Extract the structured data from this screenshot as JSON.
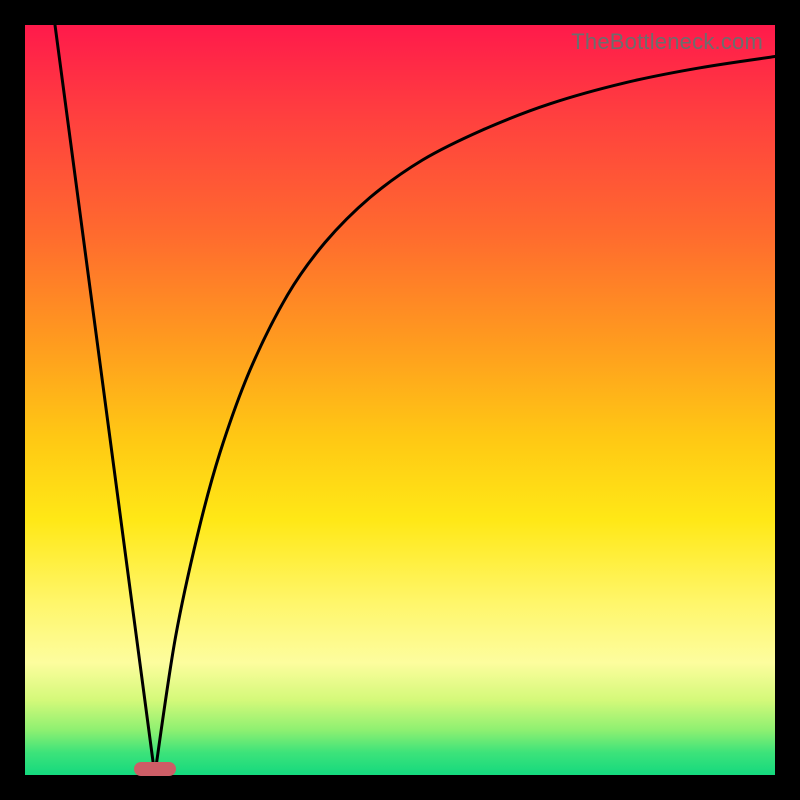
{
  "watermark": "TheBottleneck.com",
  "chart_data": {
    "type": "line",
    "title": "",
    "xlabel": "",
    "ylabel": "",
    "xlim": [
      0,
      100
    ],
    "ylim": [
      0,
      100
    ],
    "grid": false,
    "series": [
      {
        "name": "left-branch",
        "x": [
          4,
          17.3
        ],
        "y": [
          100,
          0
        ]
      },
      {
        "name": "right-branch",
        "x": [
          17.3,
          20,
          23,
          26,
          30,
          35,
          40,
          46,
          53,
          61,
          70,
          80,
          90,
          100
        ],
        "y": [
          0,
          18,
          32,
          43,
          54,
          64,
          71,
          77,
          82,
          86,
          89.5,
          92.3,
          94.3,
          95.8
        ]
      }
    ],
    "marker": {
      "x": 17.3,
      "y": 0
    },
    "background_gradient": {
      "top": "#ff1a4b",
      "upper_mid": "#ff9a1f",
      "mid": "#ffe816",
      "lower_mid": "#fdfd9e",
      "bottom": "#14d97e"
    }
  }
}
